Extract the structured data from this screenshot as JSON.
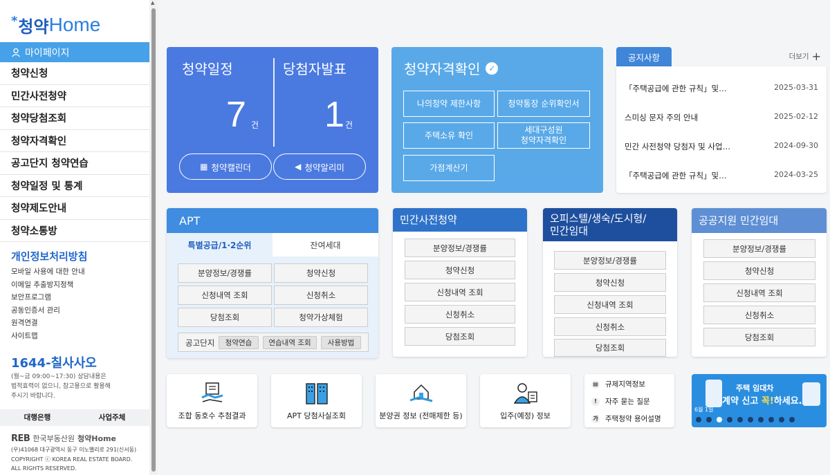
{
  "sidebar": {
    "logo_ko": "청약",
    "logo_en": "Home",
    "mypage": "마이페이지",
    "menu": [
      "청약신청",
      "민간사전청약",
      "청약당첨조회",
      "청약자격확인",
      "공고단지 청약연습",
      "청약일정 및 통계",
      "청약제도안내",
      "청약소통방"
    ],
    "privacy": "개인정보처리방침",
    "links": [
      "모바일 사용에 대한 안내",
      "이메일 추출방지정책",
      "보안프로그램",
      "공동인증서 관리",
      "원격연결",
      "사이트맵"
    ],
    "phone": "1644-칠사사오",
    "phone_note": [
      "(월~금 09:00~17:30) 상담내용은",
      "법적효력이 없으니, 참고용으로 활용해",
      "주시기 바랍니다."
    ],
    "banks": [
      "대행은행",
      "사업주체"
    ],
    "reb": {
      "logo": "REB",
      "name": "한국부동산원",
      "home": "청약Home"
    },
    "address": [
      "(우)41068 대구광역시 동구 이노밸리로 291(신서동)",
      "COPYRIGHT ⓒ KOREA REAL ESTATE BOARD.",
      "ALL RIGHTS RESERVED."
    ]
  },
  "schedule": {
    "left_label": "청약일정",
    "left_count": "7",
    "left_unit": "건",
    "right_label": "당첨자발표",
    "right_count": "1",
    "right_unit": "건",
    "calendar_btn": "청약캘린더",
    "alarm_btn": "청약알리미"
  },
  "qualification": {
    "title": "청약자격확인",
    "buttons": [
      "나의청약 제한사항",
      "청약통장 순위확인서",
      "주택소유 확인",
      "세대구성원\n청약자격확인",
      "가점계산기"
    ]
  },
  "notice": {
    "tab": "공지사항",
    "more": "더보기",
    "items": [
      {
        "title": "「주택공급에 관한 규칙」및…",
        "date": "2025-03-31"
      },
      {
        "title": "스미싱 문자 주의 안내",
        "date": "2025-02-12"
      },
      {
        "title": "민간 사전청약 당첨자 및 사업…",
        "date": "2024-09-30"
      },
      {
        "title": "「주택공급에 관한 규칙」및…",
        "date": "2024-03-25"
      }
    ]
  },
  "apt": {
    "title": "APT",
    "tab_special": "특별공급/1·2순위",
    "tab_remaining": "잔여세대",
    "buttons": [
      "분양정보/경쟁률",
      "청약신청",
      "신청내역 조회",
      "신청취소",
      "당첨조회",
      "청약가상체험"
    ],
    "practice_label": "공고단지",
    "practice_buttons": [
      "청약연습",
      "연습내역 조회",
      "사용방법"
    ]
  },
  "private_pre": {
    "title": "민간사전청약",
    "buttons": [
      "분양정보/경쟁률",
      "청약신청",
      "신청내역 조회",
      "신청취소",
      "당첨조회"
    ]
  },
  "officetel": {
    "title": "오피스텔/생숙/도시형/\n민간임대",
    "buttons": [
      "분양정보/경쟁률",
      "청약신청",
      "신청내역 조회",
      "신청취소",
      "당첨조회"
    ]
  },
  "public_rental": {
    "title": "공공지원 민간임대",
    "buttons": [
      "분양정보/경쟁률",
      "청약신청",
      "신청내역 조회",
      "신청취소",
      "당첨조회"
    ]
  },
  "bottom": [
    {
      "label": "조합 동호수 추첨결과",
      "icon": "lottery-icon"
    },
    {
      "label": "APT 당첨사실조회",
      "icon": "apartment-icon"
    },
    {
      "label": "분양권 정보 (전매제한 등)",
      "icon": "house-hand-icon"
    },
    {
      "label": "입주(예정) 정보",
      "icon": "resident-icon"
    }
  ],
  "faq": [
    {
      "label": "규제지역정보",
      "glyph": "▤"
    },
    {
      "label": "자주 묻는 질문",
      "glyph": "!"
    },
    {
      "label": "주택청약 용어설명",
      "glyph": "가"
    }
  ],
  "banner": {
    "line1": "6월 1일",
    "line2a": "계약 신고 ",
    "line2b": "꼭!",
    "line2c": "하세요.",
    "top": "주택 임대차"
  },
  "colors": {
    "primary": "#4a79e0",
    "sky": "#59a9e8",
    "accent": "#1e66c9"
  }
}
